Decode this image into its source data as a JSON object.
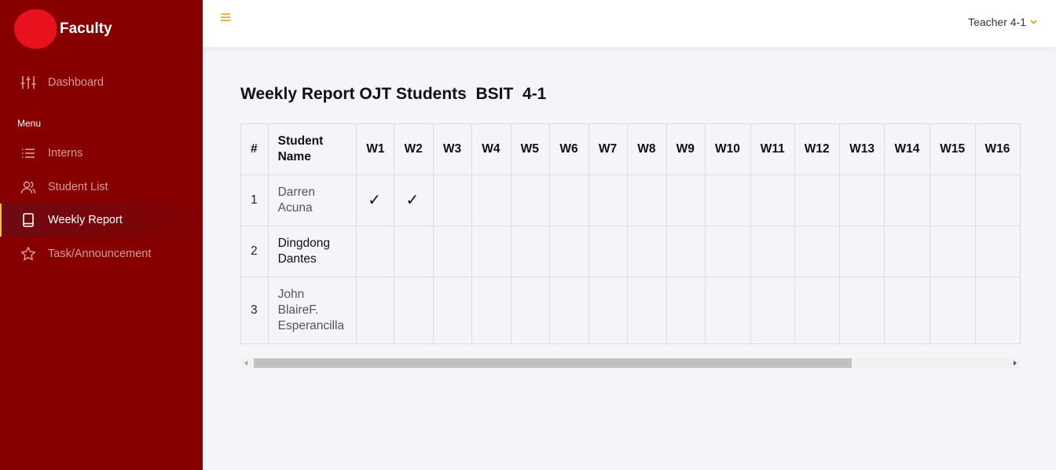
{
  "sidebar": {
    "brand": "Faculty",
    "menu_caption": "Menu",
    "items": [
      {
        "label": "Dashboard",
        "icon": "sliders-icon"
      },
      {
        "label": "Interns",
        "icon": "list-icon"
      },
      {
        "label": "Student List",
        "icon": "users-icon"
      },
      {
        "label": "Weekly Report",
        "icon": "book-icon",
        "active": true
      },
      {
        "label": "Task/Announcement",
        "icon": "star-icon"
      }
    ]
  },
  "topbar": {
    "user": "Teacher 4-1"
  },
  "main": {
    "title": "Weekly Report OJT Students  BSIT  4-1",
    "table": {
      "headers": [
        "#",
        "Student Name",
        "W1",
        "W2",
        "W3",
        "W4",
        "W5",
        "W6",
        "W7",
        "W8",
        "W9",
        "W10",
        "W11",
        "W12",
        "W13",
        "W14",
        "W15",
        "W16"
      ],
      "rows": [
        {
          "num": "1",
          "name": "Darren Acuna",
          "checks": [
            "✓",
            "✓"
          ]
        },
        {
          "num": "2",
          "name": "Dingdong Dantes",
          "checks": []
        },
        {
          "num": "3",
          "name": "John BlaireF. Esperancilla",
          "checks": []
        }
      ]
    }
  },
  "colors": {
    "sidebar": "#860000",
    "accent": "#e5a21a",
    "logo": "#e8121f"
  }
}
